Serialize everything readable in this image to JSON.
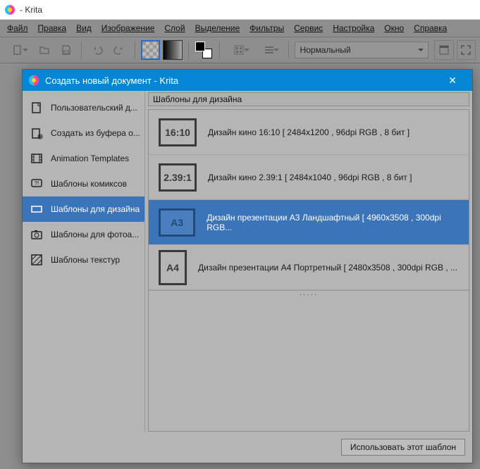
{
  "window": {
    "title": "- Krita"
  },
  "menu": {
    "items": [
      "Файл",
      "Правка",
      "Вид",
      "Изображение",
      "Слой",
      "Выделение",
      "Фильтры",
      "Сервис",
      "Настройка",
      "Окно",
      "Справка"
    ]
  },
  "toolbar": {
    "blend_mode": "Нормальный"
  },
  "dialog": {
    "title": "Создать новый документ - Krita",
    "close": "✕",
    "sidebar": {
      "items": [
        {
          "label": "Пользовательский д...",
          "icon": "custom"
        },
        {
          "label": "Создать из буфера о...",
          "icon": "clipboard"
        },
        {
          "label": "Animation Templates",
          "icon": "film"
        },
        {
          "label": "Шаблоны комиксов",
          "icon": "comic"
        },
        {
          "label": "Шаблоны для дизайна",
          "icon": "design",
          "selected": true
        },
        {
          "label": "Шаблоны для фотоа...",
          "icon": "camera"
        },
        {
          "label": "Шаблоны текстур",
          "icon": "texture"
        }
      ]
    },
    "section_header": "Шаблоны для дизайна",
    "templates": [
      {
        "thumb": "16:10",
        "shape": "land",
        "label": "Дизайн кино 16:10 [ 2484x1200 , 96dpi RGB , 8 бит ]"
      },
      {
        "thumb": "2.39:1",
        "shape": "land",
        "label": "Дизайн кино 2.39:1 [ 2484x1040 , 96dpi RGB , 8 бит ]"
      },
      {
        "thumb": "A3",
        "shape": "land",
        "label": "Дизайн презентации A3 Ландшафтный [ 4960x3508 , 300dpi RGB...",
        "selected": true
      },
      {
        "thumb": "A4",
        "shape": "port",
        "label": "Дизайн презентации A4 Портретный [ 2480x3508 , 300dpi RGB , ..."
      }
    ],
    "footer": {
      "use_template": "Использовать этот шаблон"
    }
  }
}
